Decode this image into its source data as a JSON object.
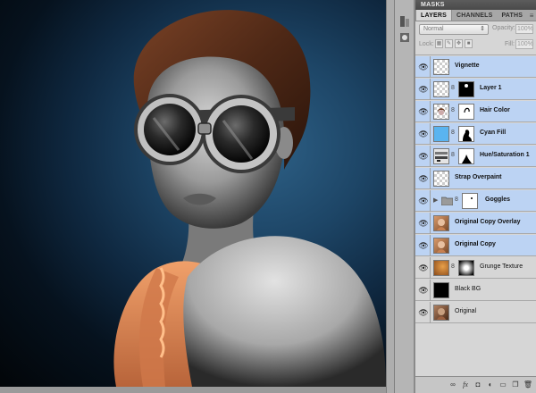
{
  "panel": {
    "top_bar_title": "MASKS",
    "tabs": [
      "LAYERS",
      "CHANNELS",
      "PATHS"
    ],
    "blend_mode": "Normal",
    "opacity_label": "Opacity:",
    "opacity_value": "100%",
    "lock_label": "Lock:",
    "fill_label": "Fill:",
    "fill_value": "100%"
  },
  "layers": [
    {
      "name": "Vignette",
      "selected": true
    },
    {
      "name": "Layer 1",
      "selected": true
    },
    {
      "name": "Hair Color",
      "selected": true
    },
    {
      "name": "Cyan Fill",
      "selected": true
    },
    {
      "name": "Hue/Saturation 1",
      "selected": true
    },
    {
      "name": "Strap Overpaint",
      "selected": true
    },
    {
      "name": "Goggles",
      "selected": true
    },
    {
      "name": "Original Copy Overlay",
      "selected": true
    },
    {
      "name": "Original Copy",
      "selected": true
    },
    {
      "name": "Grunge Texture",
      "selected": false
    },
    {
      "name": "Black BG",
      "selected": false
    },
    {
      "name": "Original",
      "selected": false
    }
  ],
  "colors": {
    "selection": "#bcd3f3",
    "cyan_fill": "#5ab4f0",
    "canvas_bg": "#1d4566"
  },
  "icons": {
    "visibility": "eye-icon",
    "link": "chain-icon",
    "group": "folder-icon"
  }
}
